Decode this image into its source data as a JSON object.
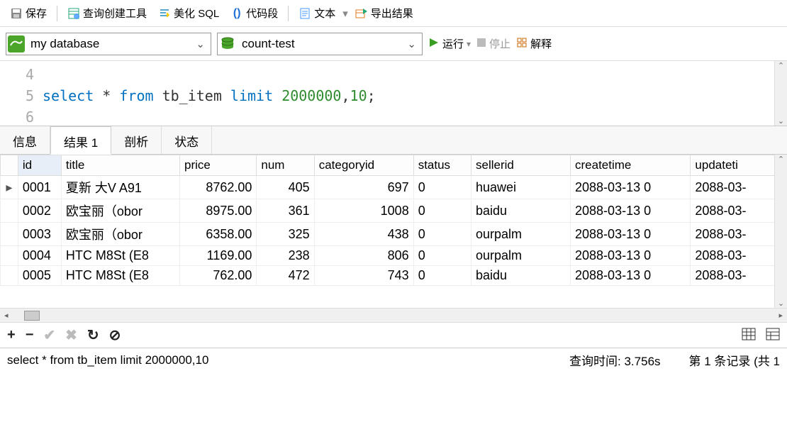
{
  "toolbar1": {
    "save": "保存",
    "query_builder": "查询创建工具",
    "beautify": "美化 SQL",
    "snippet": "代码段",
    "text": "文本",
    "export": "导出结果"
  },
  "toolbar2": {
    "connection": "my database",
    "database": "count-test",
    "run": "运行",
    "stop": "停止",
    "explain": "解释"
  },
  "editor": {
    "lines": [
      {
        "num": "4",
        "tokens": []
      },
      {
        "num": "5",
        "tokens": [
          {
            "t": "select",
            "c": "kw"
          },
          {
            "t": " * ",
            "c": "pun"
          },
          {
            "t": "from",
            "c": "kw"
          },
          {
            "t": " tb_item ",
            "c": "pun"
          },
          {
            "t": "limit",
            "c": "kw"
          },
          {
            "t": " ",
            "c": "pun"
          },
          {
            "t": "2000000",
            "c": "num"
          },
          {
            "t": ",",
            "c": "pun"
          },
          {
            "t": "10",
            "c": "num"
          },
          {
            "t": ";",
            "c": "pun"
          }
        ]
      },
      {
        "num": "6",
        "tokens": []
      }
    ]
  },
  "tabs": {
    "info": "信息",
    "result1": "结果 1",
    "profile": "剖析",
    "status": "状态"
  },
  "grid": {
    "headers": [
      "id",
      "title",
      "price",
      "num",
      "categoryid",
      "status",
      "sellerid",
      "createtime",
      "updateti"
    ],
    "rows": [
      {
        "mark": "▸",
        "id": "0001",
        "title": "夏新 大V A91",
        "price": "8762.00",
        "num": "405",
        "categoryid": "697",
        "status": "0",
        "sellerid": "huawei",
        "createtime": "2088-03-13 0",
        "updatetime": "2088-03-"
      },
      {
        "mark": "",
        "id": "0002",
        "title": "欧宝丽（obor",
        "price": "8975.00",
        "num": "361",
        "categoryid": "1008",
        "status": "0",
        "sellerid": "baidu",
        "createtime": "2088-03-13 0",
        "updatetime": "2088-03-"
      },
      {
        "mark": "",
        "id": "0003",
        "title": "欧宝丽（obor",
        "price": "6358.00",
        "num": "325",
        "categoryid": "438",
        "status": "0",
        "sellerid": "ourpalm",
        "createtime": "2088-03-13 0",
        "updatetime": "2088-03-"
      },
      {
        "mark": "",
        "id": "0004",
        "title": "HTC M8St (E8",
        "price": "1169.00",
        "num": "238",
        "categoryid": "806",
        "status": "0",
        "sellerid": "ourpalm",
        "createtime": "2088-03-13 0",
        "updatetime": "2088-03-"
      },
      {
        "mark": "",
        "id": "0005",
        "title": "HTC M8St (E8",
        "price": "762.00",
        "num": "472",
        "categoryid": "743",
        "status": "0",
        "sellerid": "baidu",
        "createtime": "2088-03-13 0",
        "updatetime": "2088-03-"
      }
    ]
  },
  "status": {
    "sql": "select * from tb_item limit 2000000,10",
    "time": "查询时间: 3.756s",
    "record": "第 1 条记录 (共 1"
  }
}
